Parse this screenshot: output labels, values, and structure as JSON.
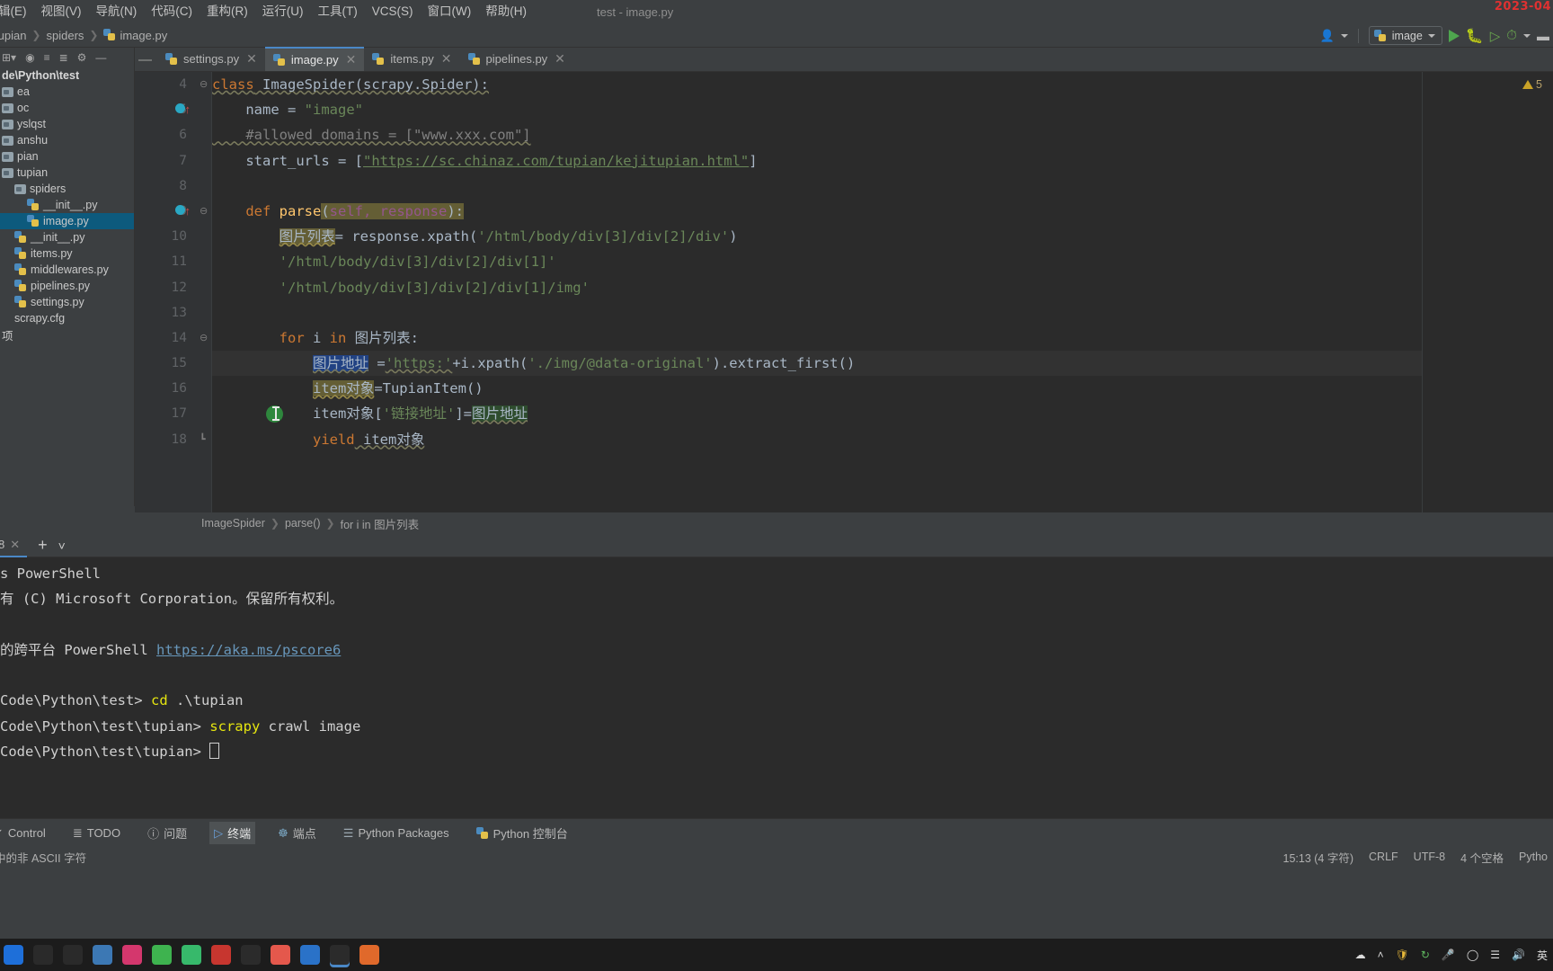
{
  "window": {
    "title": "test - image.py",
    "watermark": "2023-04"
  },
  "menubar": {
    "items": [
      "辑(E)",
      "视图(V)",
      "导航(N)",
      "代码(C)",
      "重构(R)",
      "运行(U)",
      "工具(T)",
      "VCS(S)",
      "窗口(W)",
      "帮助(H)"
    ]
  },
  "navbar": {
    "breadcrumb": [
      "tupian",
      "spiders",
      "image.py"
    ],
    "profile_icon": "user-icon",
    "run_config": "image",
    "buttons": [
      "run-button",
      "debug-button",
      "coverage-button",
      "profile-button"
    ]
  },
  "project_panel": {
    "root": "de\\Python\\test",
    "items": [
      {
        "label": "ea",
        "indent": 0,
        "type": "folder",
        "selected": false
      },
      {
        "label": "oc",
        "indent": 0,
        "type": "folder",
        "selected": false
      },
      {
        "label": "yslqst",
        "indent": 0,
        "type": "folder",
        "selected": false
      },
      {
        "label": "anshu",
        "indent": 0,
        "type": "folder",
        "selected": false
      },
      {
        "label": "pian",
        "indent": 0,
        "type": "folder",
        "selected": false
      },
      {
        "label": "tupian",
        "indent": 0,
        "type": "folder",
        "selected": false
      },
      {
        "label": "spiders",
        "indent": 1,
        "type": "folder",
        "selected": false
      },
      {
        "label": "__init__.py",
        "indent": 2,
        "type": "py",
        "selected": false
      },
      {
        "label": "image.py",
        "indent": 2,
        "type": "py",
        "selected": true
      },
      {
        "label": "__init__.py",
        "indent": 1,
        "type": "py",
        "selected": false
      },
      {
        "label": "items.py",
        "indent": 1,
        "type": "py",
        "selected": false
      },
      {
        "label": "middlewares.py",
        "indent": 1,
        "type": "py",
        "selected": false
      },
      {
        "label": "pipelines.py",
        "indent": 1,
        "type": "py",
        "selected": false
      },
      {
        "label": "settings.py",
        "indent": 1,
        "type": "py",
        "selected": false
      },
      {
        "label": "scrapy.cfg",
        "indent": 1,
        "type": "file",
        "selected": false
      },
      {
        "label": "项",
        "indent": 0,
        "type": "file",
        "selected": false
      }
    ]
  },
  "tabs": [
    {
      "label": "settings.py",
      "active": false
    },
    {
      "label": "image.py",
      "active": true
    },
    {
      "label": "items.py",
      "active": false
    },
    {
      "label": "pipelines.py",
      "active": false
    }
  ],
  "editor": {
    "warning_count": "5",
    "first_line_number": 4,
    "lines": [
      {
        "n": 4,
        "fold": "minus",
        "marker": "none",
        "current": false
      },
      {
        "n": 5,
        "fold": "none",
        "marker": "breakpoint",
        "current": false
      },
      {
        "n": 6,
        "fold": "none",
        "marker": "none",
        "current": false
      },
      {
        "n": 7,
        "fold": "none",
        "marker": "none",
        "current": false
      },
      {
        "n": 8,
        "fold": "none",
        "marker": "none",
        "current": false
      },
      {
        "n": 9,
        "fold": "minus",
        "marker": "breakpoint",
        "current": false
      },
      {
        "n": 10,
        "fold": "none",
        "marker": "none",
        "current": false
      },
      {
        "n": 11,
        "fold": "none",
        "marker": "none",
        "current": false
      },
      {
        "n": 12,
        "fold": "none",
        "marker": "none",
        "current": false
      },
      {
        "n": 13,
        "fold": "none",
        "marker": "none",
        "current": false
      },
      {
        "n": 14,
        "fold": "minus",
        "marker": "none",
        "current": false
      },
      {
        "n": 15,
        "fold": "none",
        "marker": "none",
        "current": true
      },
      {
        "n": 16,
        "fold": "none",
        "marker": "none",
        "current": false
      },
      {
        "n": 17,
        "fold": "none",
        "marker": "none",
        "current": false
      },
      {
        "n": 18,
        "fold": "end",
        "marker": "none",
        "current": false
      }
    ],
    "code": {
      "l4_kw": "class",
      "l4_name": " ImageSpider(scrapy.Spider):",
      "l5": "    name = ",
      "l5_str": "\"image\"",
      "l6": "    #allowed_domains = [\"www.xxx.com\"]",
      "l7_a": "    start_urls = [",
      "l7_str": "\"https://sc.chinaz.com/tupian/kejitupian.html\"",
      "l7_b": "]",
      "l9_kw": "    def ",
      "l9_fn": "parse",
      "l9_p1": "(",
      "l9_self": "self, response",
      "l9_p2": "):",
      "l10_var": "图片列表",
      "l10_mid": "= response.xpath(",
      "l10_str": "'/html/body/div[3]/div[2]/div'",
      "l10_end": ")",
      "l11_str": "        '/html/body/div[3]/div[2]/div[1]'",
      "l12_str": "        '/html/body/div[3]/div[2]/div[1]/img'",
      "l14_for": "for",
      "l14_i": " i ",
      "l14_in": "in",
      "l14_rest": " 图片列表:",
      "l15_var": "图片地址",
      "l15_eq": " =",
      "l15_str1": "'https:'",
      "l15_mid": "+i.xpath(",
      "l15_str2": "'./img/@data-original'",
      "l15_end": ").extract_first()",
      "l16_var": "item对象",
      "l16_rest": "=TupianItem()",
      "l17_a": "item对",
      "l17_b": "象",
      "l17_c": "[",
      "l17_str": "'链接地址'",
      "l17_d": "]=",
      "l17_e": "图片地址",
      "l18_kw": "yield",
      "l18_rest": " item对象"
    },
    "breadcrumb": [
      "ImageSpider",
      "parse()",
      "for i in 图片列表"
    ]
  },
  "terminal": {
    "tab_label": "8",
    "add_icon": "plus-icon",
    "chevron_icon": "chevron-down-icon",
    "lines": [
      {
        "text": "s PowerShell",
        "type": "plain"
      },
      {
        "text": "有 (C) Microsoft Corporation。保留所有权利。",
        "type": "plain"
      },
      {
        "text": "",
        "type": "plain"
      },
      {
        "text": "的跨平台 PowerShell ",
        "type": "link",
        "link": "https://aka.ms/pscore6"
      },
      {
        "text": "",
        "type": "plain"
      },
      {
        "prompt": "Code\\Python\\test> ",
        "cmd": "cd",
        "args": " .\\tupian",
        "type": "cmd"
      },
      {
        "prompt": "Code\\Python\\test\\tupian> ",
        "cmd": "scrapy",
        "args": " crawl image",
        "type": "cmd"
      },
      {
        "prompt": "Code\\Python\\test\\tupian> ",
        "cmd": "",
        "args": "",
        "type": "cursor"
      }
    ]
  },
  "bottom_tools": [
    {
      "label": "Control",
      "icon": "version-control-icon",
      "active": false
    },
    {
      "label": "TODO",
      "icon": "todo-icon",
      "active": false
    },
    {
      "label": "问题",
      "icon": "problems-icon",
      "active": false
    },
    {
      "label": "终端",
      "icon": "terminal-icon",
      "active": true
    },
    {
      "label": "端点",
      "icon": "endpoints-icon",
      "active": false
    },
    {
      "label": "Python Packages",
      "icon": "packages-icon",
      "active": false
    },
    {
      "label": "Python 控制台",
      "icon": "python-console-icon",
      "active": false
    }
  ],
  "statusbar": {
    "left": "中的非 ASCII 字符",
    "caret": "15:13 (4 字符)",
    "line_sep": "CRLF",
    "encoding": "UTF-8",
    "indent": "4 个空格",
    "interpreter": "Pytho"
  },
  "taskbar": {
    "icons": [
      {
        "name": "start-icon",
        "color": "#1e6fd9"
      },
      {
        "name": "search-icon",
        "color": "#2a2a2a"
      },
      {
        "name": "taskview-icon",
        "color": "#2a2a2a"
      },
      {
        "name": "explorer-icon",
        "color": "#3c78b4"
      },
      {
        "name": "camera-icon",
        "color": "#d4376d"
      },
      {
        "name": "wechat-icon",
        "color": "#3eb34f"
      },
      {
        "name": "qq-icon",
        "color": "#37b96b"
      },
      {
        "name": "opera-icon",
        "color": "#c7362f"
      },
      {
        "name": "terminal-icon",
        "color": "#2b2b2b"
      },
      {
        "name": "chrome-icon",
        "color": "#e4584c"
      },
      {
        "name": "store-icon",
        "color": "#2a72c8"
      },
      {
        "name": "pycharm-icon",
        "color": "#2b2b2b",
        "selected": true
      },
      {
        "name": "firefox-icon",
        "color": "#e0692b"
      }
    ],
    "tray": [
      "cloud-icon",
      "chevron-up-icon",
      "shield-icon",
      "sync-icon",
      "mic-icon",
      "circle-icon",
      "wifi-icon",
      "volume-icon",
      "ime-label"
    ],
    "ime": "英"
  },
  "colors": {
    "accent": "#4a88c7",
    "panel": "#3c3f41",
    "editor_bg": "#2b2b2b",
    "selection": "#214283",
    "search_hl": "#645e35",
    "run_green": "#4ea54e",
    "watermark_red": "#e03131"
  }
}
